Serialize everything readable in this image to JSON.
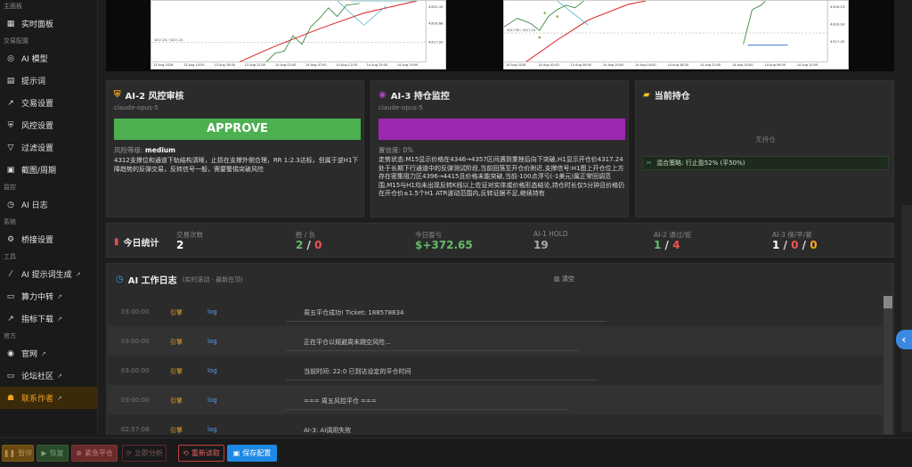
{
  "sidebar": {
    "sections": [
      {
        "title": "主面板",
        "items": [
          {
            "label": "实时面板",
            "icon": "dashboard-icon",
            "glyph": "▦"
          }
        ]
      },
      {
        "title": "交易配置",
        "items": [
          {
            "label": "AI 模型",
            "icon": "robot-icon",
            "glyph": "◎"
          },
          {
            "label": "提示词",
            "icon": "document-icon",
            "glyph": "▤"
          },
          {
            "label": "交易设置",
            "icon": "trend-icon",
            "glyph": "↗"
          },
          {
            "label": "风控设置",
            "icon": "shield-icon",
            "glyph": "⛨"
          },
          {
            "label": "过滤设置",
            "icon": "filter-icon",
            "glyph": "▽"
          },
          {
            "label": "截图/周期",
            "icon": "image-icon",
            "glyph": "▣"
          }
        ]
      },
      {
        "title": "监控",
        "items": [
          {
            "label": "AI 日志",
            "icon": "history-icon",
            "glyph": "◷"
          }
        ]
      },
      {
        "title": "系统",
        "items": [
          {
            "label": "桥接设置",
            "icon": "gear-icon",
            "glyph": "⚙"
          }
        ]
      },
      {
        "title": "工具",
        "items": [
          {
            "label": "AI 提示词生成",
            "icon": "wand-icon",
            "glyph": "⁄",
            "ext": true
          },
          {
            "label": "算力中转",
            "icon": "chat-icon",
            "glyph": "▭",
            "ext": true
          },
          {
            "label": "指标下载",
            "icon": "chart-line-icon",
            "glyph": "↗",
            "ext": true
          }
        ]
      },
      {
        "title": "官方",
        "items": [
          {
            "label": "官网",
            "icon": "globe-icon",
            "glyph": "◉",
            "ext": true
          },
          {
            "label": "论坛社区",
            "icon": "comments-icon",
            "glyph": "▭",
            "ext": true
          },
          {
            "label": "联系作者",
            "icon": "user-icon",
            "glyph": "☗",
            "ext": true,
            "active": true
          }
        ]
      }
    ]
  },
  "charts": {
    "left": {
      "price_labels": [
        "4352.43",
        "4329.68",
        "4317.93"
      ],
      "annot": "4317.24 / 4317.24",
      "times": [
        "13 Aug 2026",
        "13 Aug 14:00",
        "13 Aug 18:00",
        "13 Aug 22:00",
        "14 Aug 02:00",
        "14 Aug 07:00",
        "14 Aug 11:00",
        "14 Aug 15:00",
        "14 Aug 19:00"
      ]
    },
    "right": {
      "price_labels": [
        "4339.23",
        "4329.93",
        "4317.45"
      ],
      "annot": "4317.90 / 4317.24",
      "times": [
        "14 Aug 2026",
        "14 Aug 02:00",
        "14 Aug 06:00",
        "14 Aug 10:00",
        "14 Aug 14:00",
        "14 Aug 18:00",
        "14 Aug 22:00",
        "14 Aug 02:00",
        "14 Aug 06:00",
        "14 Aug 10:00"
      ]
    }
  },
  "ai2": {
    "title": "AI-2 风控审核",
    "model": "claude-opus-5",
    "decision": "APPROVE",
    "risk_label": "风险等级:",
    "risk_value": "medium",
    "text": "4312支撑位和通道下轨结构清晰，止损在支撑外侧合理，RR 1:2.3达标，但属于逆H1下降趋势的反弹交易，反转信号一般，需要警惕突破风险"
  },
  "ai3": {
    "title": "AI-3 持仓监控",
    "model": "claude-opus-5",
    "confidence": "置信度: 0%",
    "text": "走势状态:M15显示价格在4346→4357区间遇到重挫后向下突破,H1显示开仓价4317.24处于长期下行通道中的反弹测试阶段,当前回落至开仓价附近,支撑信号:H1图上开仓位上方存在密集阻力区4396→4415且价格未能突破,当前-100点浮亏(-1美元)属正常回调范围,M15与H1均未出现反转K线以上佐证对实体或价格形态结论,持仓时长仅5分钟且价格仍在开仓价±1.5个H1 ATR波动范围内,反转证据不足,继续持有"
  },
  "holding": {
    "title": "当前持仓",
    "empty": "无持仓",
    "hint": "混合策略: 行止盈52% (平50%)"
  },
  "stats": {
    "title": "今日统计",
    "items": [
      {
        "label": "交易次数",
        "parts": [
          {
            "t": "2",
            "c": "#ffffff"
          }
        ]
      },
      {
        "label": "胜 / 负",
        "parts": [
          {
            "t": "2",
            "c": "#66bb6a"
          },
          {
            "t": " / ",
            "c": "#dddddd"
          },
          {
            "t": "0",
            "c": "#ef5350"
          }
        ]
      },
      {
        "label": "今日盈亏",
        "parts": [
          {
            "t": "$+372.65",
            "c": "#66bb6a"
          }
        ]
      },
      {
        "label": "AI-1 HOLD",
        "parts": [
          {
            "t": "19",
            "c": "#aaaaaa"
          }
        ]
      },
      {
        "label": "AI-2 通过/拒",
        "parts": [
          {
            "t": "1",
            "c": "#66bb6a"
          },
          {
            "t": " / ",
            "c": "#dddddd"
          },
          {
            "t": "4",
            "c": "#ef5350"
          }
        ]
      },
      {
        "label": "AI-3 保/平/紧",
        "parts": [
          {
            "t": "1",
            "c": "#ffffff"
          },
          {
            "t": " / ",
            "c": "#dddddd"
          },
          {
            "t": "0",
            "c": "#ef5350"
          },
          {
            "t": " / ",
            "c": "#dddddd"
          },
          {
            "t": "0",
            "c": "#ffa726"
          }
        ]
      }
    ]
  },
  "log": {
    "title": "AI 工作日志",
    "subtitle": "(实时滚动 · 最新在顶)",
    "clear": "清空",
    "rows": [
      {
        "time": "03:00:00",
        "source": "引擎",
        "level": "log",
        "msg": "周五平仓成功! Ticket: 188578834"
      },
      {
        "time": "03:00:00",
        "source": "引擎",
        "level": "log",
        "msg": "正在平仓以规避周末跳空风险..."
      },
      {
        "time": "03:00:00",
        "source": "引擎",
        "level": "log",
        "msg": "当前时间: 22:0 已到达设定的平仓时间"
      },
      {
        "time": "03:00:00",
        "source": "引擎",
        "level": "log",
        "msg": "=== 周五风控平仓 ==="
      },
      {
        "time": "02:57:08",
        "source": "引擎",
        "level": "log",
        "msg": "AI-3: AI调用失败"
      }
    ]
  },
  "buttons": {
    "pause": "暂停",
    "resume": "恢复",
    "close_all": "紧急平仓",
    "analyze": "立即分析",
    "reload": "重新读取",
    "save": "保存配置"
  },
  "colors": {
    "accent": "#f0a020",
    "approve": "#4caf50",
    "monitor": "#9c27b0",
    "save": "#1e88e5",
    "close_all": "#b03a3a"
  }
}
